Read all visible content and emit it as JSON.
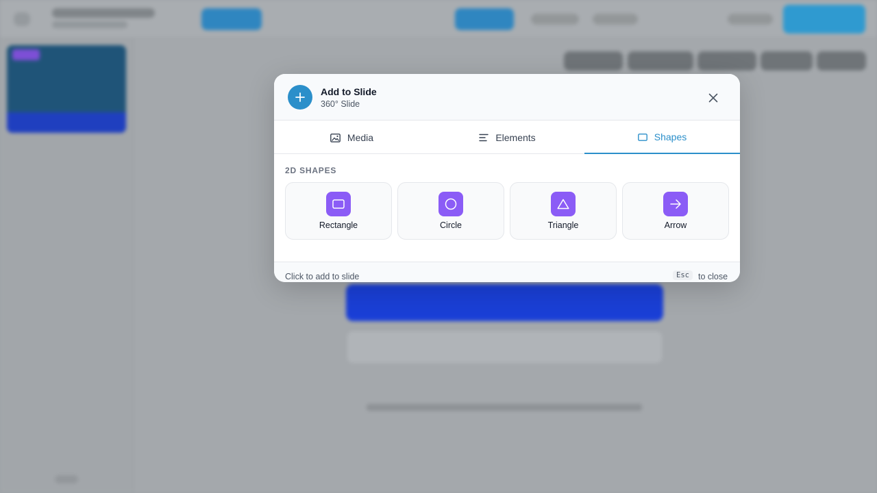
{
  "modal": {
    "title": "Add to Slide",
    "subtitle": "360° Slide",
    "header_icon": "plus-icon",
    "close_icon": "close-icon"
  },
  "tabs": [
    {
      "label": "Media",
      "icon": "image-icon",
      "active": false
    },
    {
      "label": "Elements",
      "icon": "text-lines-icon",
      "active": false
    },
    {
      "label": "Shapes",
      "icon": "rectangle-outline-icon",
      "active": true
    }
  ],
  "section": {
    "label": "2D SHAPES"
  },
  "shapes": [
    {
      "label": "Rectangle",
      "icon": "rectangle-icon"
    },
    {
      "label": "Circle",
      "icon": "circle-icon"
    },
    {
      "label": "Triangle",
      "icon": "triangle-icon"
    },
    {
      "label": "Arrow",
      "icon": "arrow-right-icon"
    }
  ],
  "footer": {
    "hint": "Click to add to slide",
    "key": "Esc",
    "key_hint": "to close"
  },
  "colors": {
    "accent": "#2b8fca",
    "shape_icon_bg": "#8b5cf6",
    "overlay": "#9ea3a7"
  }
}
